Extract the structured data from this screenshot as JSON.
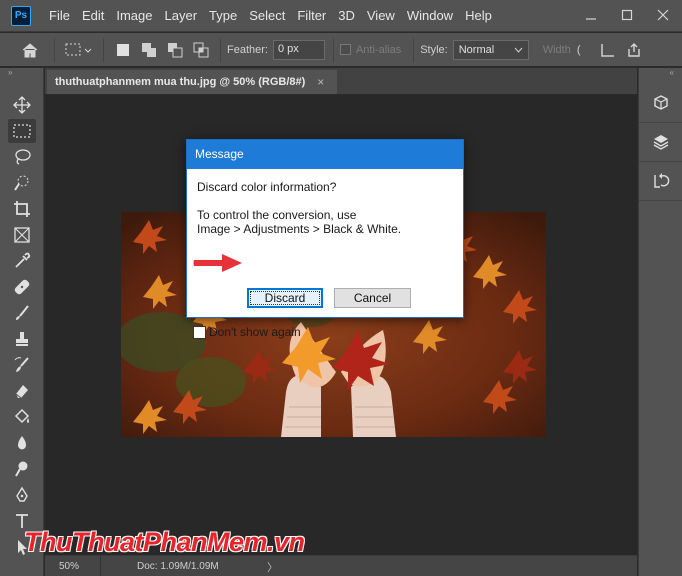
{
  "app": {
    "logo_text": "Ps",
    "menu": [
      "File",
      "Edit",
      "Image",
      "Layer",
      "Type",
      "Select",
      "Filter",
      "3D",
      "View",
      "Window",
      "Help"
    ]
  },
  "options_bar": {
    "feather_label": "Feather:",
    "feather_value": "0 px",
    "antialias_label": "Anti-alias",
    "style_label": "Style:",
    "style_value": "Normal",
    "width_label": "Width"
  },
  "document": {
    "tab_title": "thuthuatphanmem mua thu.jpg @ 50% (RGB/8#)",
    "tab_close": "×"
  },
  "status": {
    "zoom": "50%",
    "doc": "Doc: 1.09M/1.09M",
    "arrow": "〉"
  },
  "dialog": {
    "title": "Message",
    "message_line1": "Discard color information?",
    "message_line2": "To control the conversion, use",
    "message_line3": "Image > Adjustments > Black & White.",
    "discard_label": "Discard",
    "cancel_label": "Cancel",
    "dont_show_label": "Don't show again"
  },
  "watermark": {
    "text": "ThuThuatPhanMem.vn"
  },
  "colors": {
    "ui_dark": "#535353",
    "canvas_bg": "#282828",
    "dialog_title": "#1f7bd8",
    "accent_blue": "#0078d7",
    "arrow_red": "#e8323a",
    "watermark_red": "#e8232a"
  },
  "icons": {
    "toolbar": [
      "move-icon",
      "marquee-icon",
      "lasso-icon",
      "quick-select-icon",
      "crop-icon",
      "frame-icon",
      "eyedropper-icon",
      "healing-icon",
      "brush-icon",
      "stamp-icon",
      "history-brush-icon",
      "eraser-icon",
      "paint-bucket-icon",
      "blur-icon",
      "dodge-icon",
      "pen-icon",
      "type-icon",
      "path-select-icon"
    ],
    "right_panel": [
      "3d-icon",
      "layers-icon",
      "history-icon"
    ]
  }
}
